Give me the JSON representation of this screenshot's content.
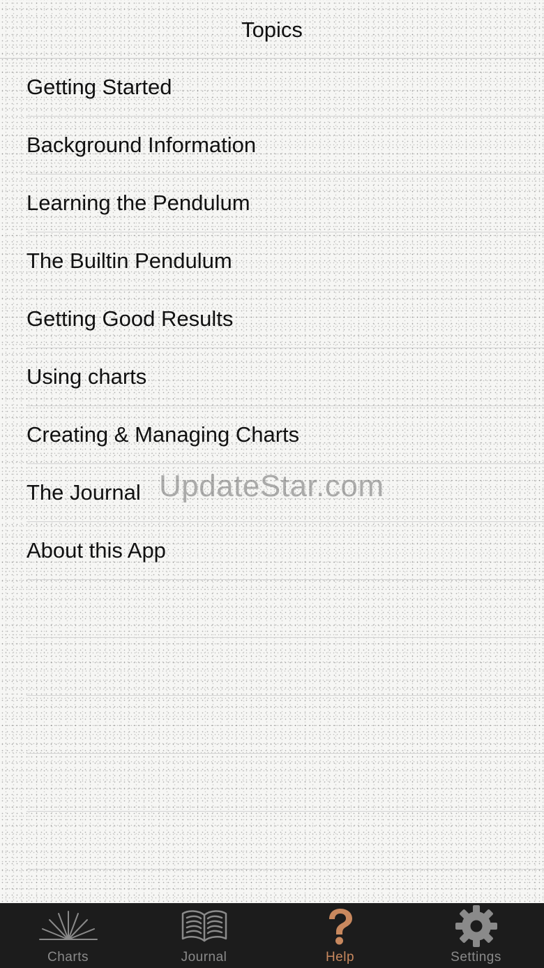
{
  "nav": {
    "title": "Topics"
  },
  "topics": [
    {
      "label": "Getting Started"
    },
    {
      "label": "Background Information"
    },
    {
      "label": "Learning the Pendulum"
    },
    {
      "label": "The Builtin Pendulum"
    },
    {
      "label": "Getting Good Results"
    },
    {
      "label": "Using charts"
    },
    {
      "label": "Creating & Managing Charts"
    },
    {
      "label": "The Journal"
    },
    {
      "label": "About this App"
    }
  ],
  "watermark": "UpdateStar.com",
  "tabs": [
    {
      "label": "Charts",
      "icon": "charts-fan-icon",
      "active": false
    },
    {
      "label": "Journal",
      "icon": "open-book-icon",
      "active": false
    },
    {
      "label": "Help",
      "icon": "question-mark-icon",
      "active": true
    },
    {
      "label": "Settings",
      "icon": "gear-icon",
      "active": false
    }
  ],
  "colors": {
    "tab_bar_background": "#1c1c1c",
    "tab_inactive": "#8a8a8a",
    "tab_active": "#c8885e"
  }
}
